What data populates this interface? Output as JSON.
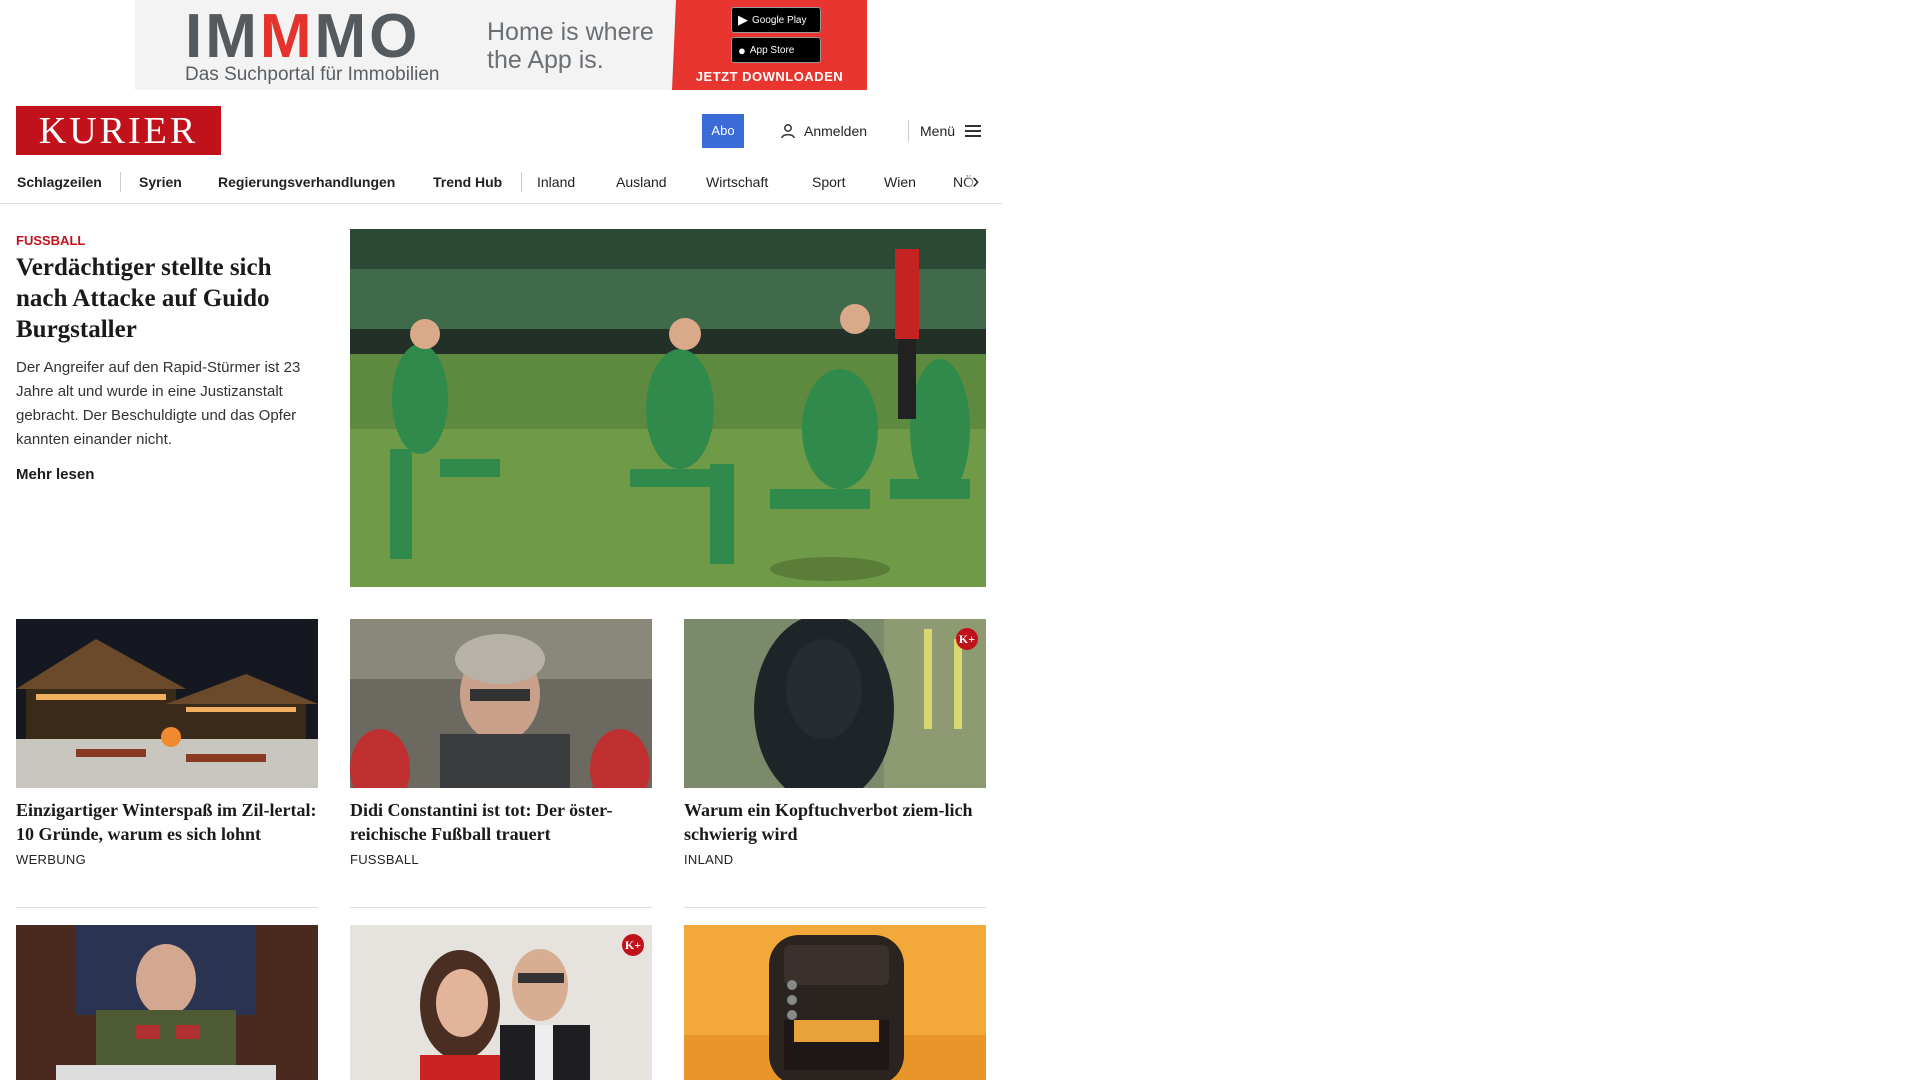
{
  "ad": {
    "logo_parts": [
      "IM",
      "M",
      "MO"
    ],
    "subtitle": "Das Suchportal für Immobilien",
    "tagline": "Home is where the App is.",
    "google_play": "Google Play",
    "app_store": "App Store",
    "cta": "JETZT DOWNLOADEN"
  },
  "header": {
    "logo": "KURIER",
    "abo": "Abo",
    "login": "Anmelden",
    "menu": "Menü"
  },
  "nav": {
    "items": [
      "Schlagzeilen",
      "Syrien",
      "Regierungsverhandlungen",
      "Trend Hub",
      "Inland",
      "Ausland",
      "Wirtschaft",
      "Sport",
      "Wien",
      "NÖ"
    ]
  },
  "lead": {
    "kicker": "FUSSBALL",
    "title": "Verdächtiger stellte sich nach Attacke auf Guido Burgstaller",
    "teaser": "Der Angreifer auf den Rapid-Stürmer ist 23 Jahre alt und wurde in eine Justizanstalt gebracht. Der Beschuldigte und das Opfer kannten einander nicht.",
    "more": "Mehr lesen"
  },
  "cards": [
    {
      "title": "Einzigartiger Winterspaß im Zil-lertal: 10 Gründe, warum es sich lohnt",
      "category": "WERBUNG",
      "premium": false
    },
    {
      "title": "Didi Constantini ist tot: Der öster-reichische Fußball trauert",
      "category": "FUSSBALL",
      "premium": false
    },
    {
      "title": "Warum ein Kopftuchverbot ziem-lich schwierig wird",
      "category": "INLAND",
      "premium": true
    }
  ],
  "cards_row2": [
    {
      "premium": false
    },
    {
      "premium": true
    },
    {
      "premium": false
    }
  ],
  "premium_badge": "K+",
  "colors": {
    "brand": "#c1121c",
    "abo": "#3a6bd6"
  }
}
